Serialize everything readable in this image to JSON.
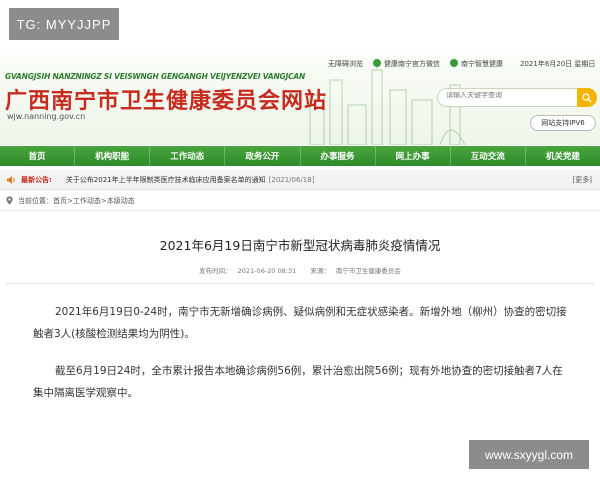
{
  "watermarks": {
    "top_left": "TG: MYYJJPP",
    "bottom_right": "www.sxyygl.com"
  },
  "header": {
    "pinyin": "GVANGJSIH NANZNINGZ SI VEISWNGH GENGANGH VEIJYENZVEI VANGJCAN",
    "title": "广西南宁市卫生健康委员会网站",
    "domain": "wjw.nanning.gov.cn",
    "top_links": [
      "无障碍浏览",
      "健康南宁官方微信",
      "南宁智慧健康"
    ],
    "date": "2021年6月20日 星期日",
    "search_placeholder": "请输入关键字查询",
    "ipv6": "网站支持IPV6"
  },
  "nav": [
    "首页",
    "机构职能",
    "工作动态",
    "政务公开",
    "办事服务",
    "网上办事",
    "互动交流",
    "机关党建"
  ],
  "ticker": {
    "label": "最新公告:",
    "title": "关于公布2021年上半年限制类医疗技术临床应用备案名单的通知",
    "date": "[2021/06/18]",
    "more": "[更多]"
  },
  "breadcrumb": {
    "prefix": "当前位置：",
    "items": [
      "首页",
      "工作动态",
      "本级动态"
    ],
    "sep": " > "
  },
  "article": {
    "title": "2021年6月19日南宁市新型冠状病毒肺炎疫情情况",
    "published_label": "发布时间：",
    "published": "2021-06-20 08:31",
    "source_label": "来源：",
    "source": "南宁市卫生健康委员会",
    "paragraphs": [
      "2021年6月19日0-24时，南宁市无新增确诊病例、疑似病例和无症状感染者。新增外地（柳州）协查的密切接触者3人(核酸检测结果均为阴性)。",
      "截至6月19日24时，全市累计报告本地确诊病例56例，累计治愈出院56例；现有外地协查的密切接触者7人在集中隔离医学观察中。"
    ]
  },
  "colors": {
    "nav_green": "#3a9a33",
    "title_red": "#c52b1e",
    "search_button": "#f4b400"
  }
}
